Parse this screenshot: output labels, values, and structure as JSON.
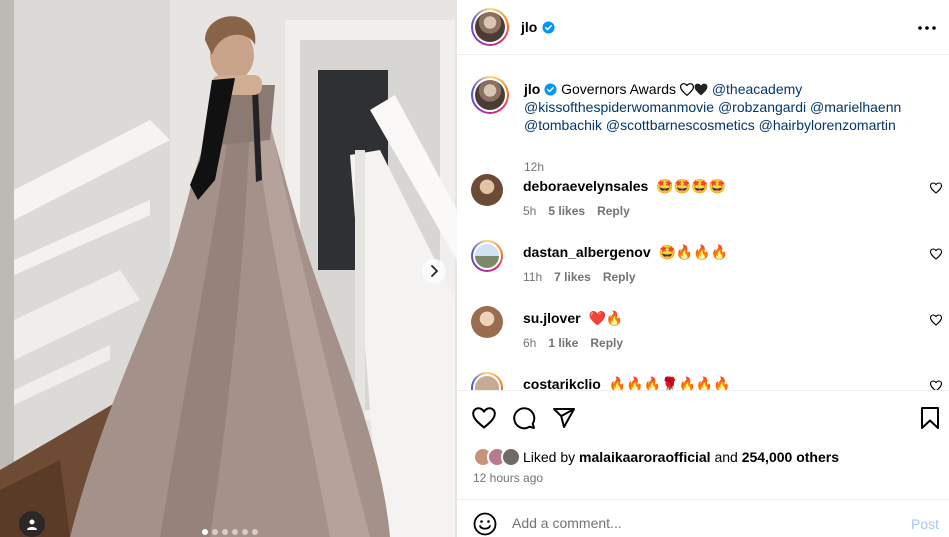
{
  "post": {
    "username": "jlo",
    "verified": true
  },
  "caption": {
    "username": "jlo",
    "text_start": "Governors Awards",
    "mentions": [
      "@theacademy",
      "@kissofthespiderwomanmovie",
      "@robzangardi",
      "@marielhaenn",
      "@tombachik",
      "@scottbarnescosmetics",
      "@hairbylorenzomartin"
    ],
    "time": "12h"
  },
  "comments": [
    {
      "username": "deboraevelynsales",
      "text": "🤩🤩🤩🤩",
      "time": "5h",
      "likes": "5 likes",
      "reply": "Reply"
    },
    {
      "username": "dastan_albergenov",
      "text": "🤩🔥🔥🔥",
      "time": "11h",
      "likes": "7 likes",
      "reply": "Reply"
    },
    {
      "username": "su.jlover",
      "text": "❤️🔥",
      "time": "6h",
      "likes": "1 like",
      "reply": "Reply"
    },
    {
      "username": "costarikclio",
      "text": "🔥🔥🔥🌹🔥🔥🔥",
      "time": "",
      "likes": "",
      "reply": ""
    }
  ],
  "likes": {
    "prefix": "Liked by",
    "user": "malaikaaroraofficial",
    "joiner": "and",
    "others": "254,000 others"
  },
  "posted_ago": "12 hours ago",
  "add_comment": {
    "placeholder": "Add a comment...",
    "post_label": "Post"
  },
  "colors": {
    "link": "#00376b",
    "verified": "#0095f6",
    "muted": "#737373",
    "post_disabled": "#a8c6f0"
  },
  "carousel": {
    "count": 6,
    "active_index": 0
  },
  "icons": [
    "verified-badge-icon",
    "more-options-icon",
    "heart-icon",
    "comment-icon",
    "share-icon",
    "bookmark-icon",
    "emoji-icon",
    "user-tag-icon",
    "chevron-right-icon"
  ]
}
